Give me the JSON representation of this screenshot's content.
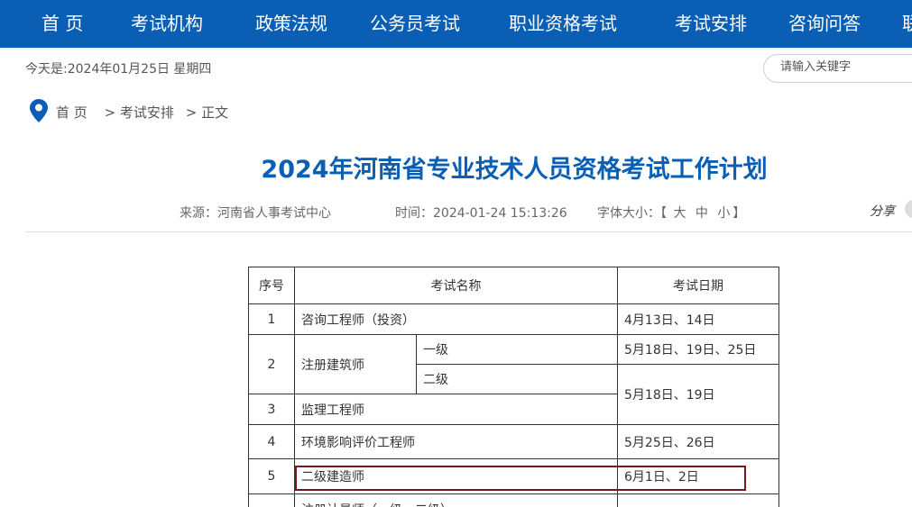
{
  "nav": {
    "items": [
      "首 页",
      "考试机构",
      "政策法规",
      "公务员考试",
      "职业资格考试",
      "考试安排",
      "咨询问答",
      "联"
    ]
  },
  "header": {
    "date_text": "今天是:2024年01月25日 星期四",
    "search_placeholder": "请输入关键字"
  },
  "breadcrumb": {
    "home": "首 页",
    "sep1": ">",
    "section": "考试安排",
    "sep2": ">",
    "current": "正文"
  },
  "article": {
    "title": "2024年河南省专业技术人员资格考试工作计划",
    "source": "来源：河南省人事考试中心",
    "time": "时间：2024-01-24 15:13:26",
    "font_size_label": "字体大小：",
    "font_size_open": "【",
    "font_size_large": "大",
    "font_size_medium": "中",
    "font_size_small": "小",
    "font_size_close": "】",
    "share": "分享"
  },
  "table": {
    "headers": [
      "序号",
      "考试名称",
      "考试日期"
    ],
    "rows": [
      {
        "no": "1",
        "name": "咨询工程师（投资）",
        "date": "4月13日、14日"
      },
      {
        "no": "2",
        "name": "注册建筑师",
        "level1": "一级",
        "date1": "5月18日、19日、25日",
        "level2": "二级"
      },
      {
        "no": "3",
        "name": "监理工程师",
        "date_shared": "5月18日、19日"
      },
      {
        "no": "4",
        "name": "环境影响评价工程师",
        "date": "5月25日、26日"
      },
      {
        "no": "5",
        "name": "二级建造师",
        "date": "6月1日、2日"
      },
      {
        "no": "",
        "name": "注册计量师（一级、二级）",
        "date": ""
      }
    ]
  }
}
